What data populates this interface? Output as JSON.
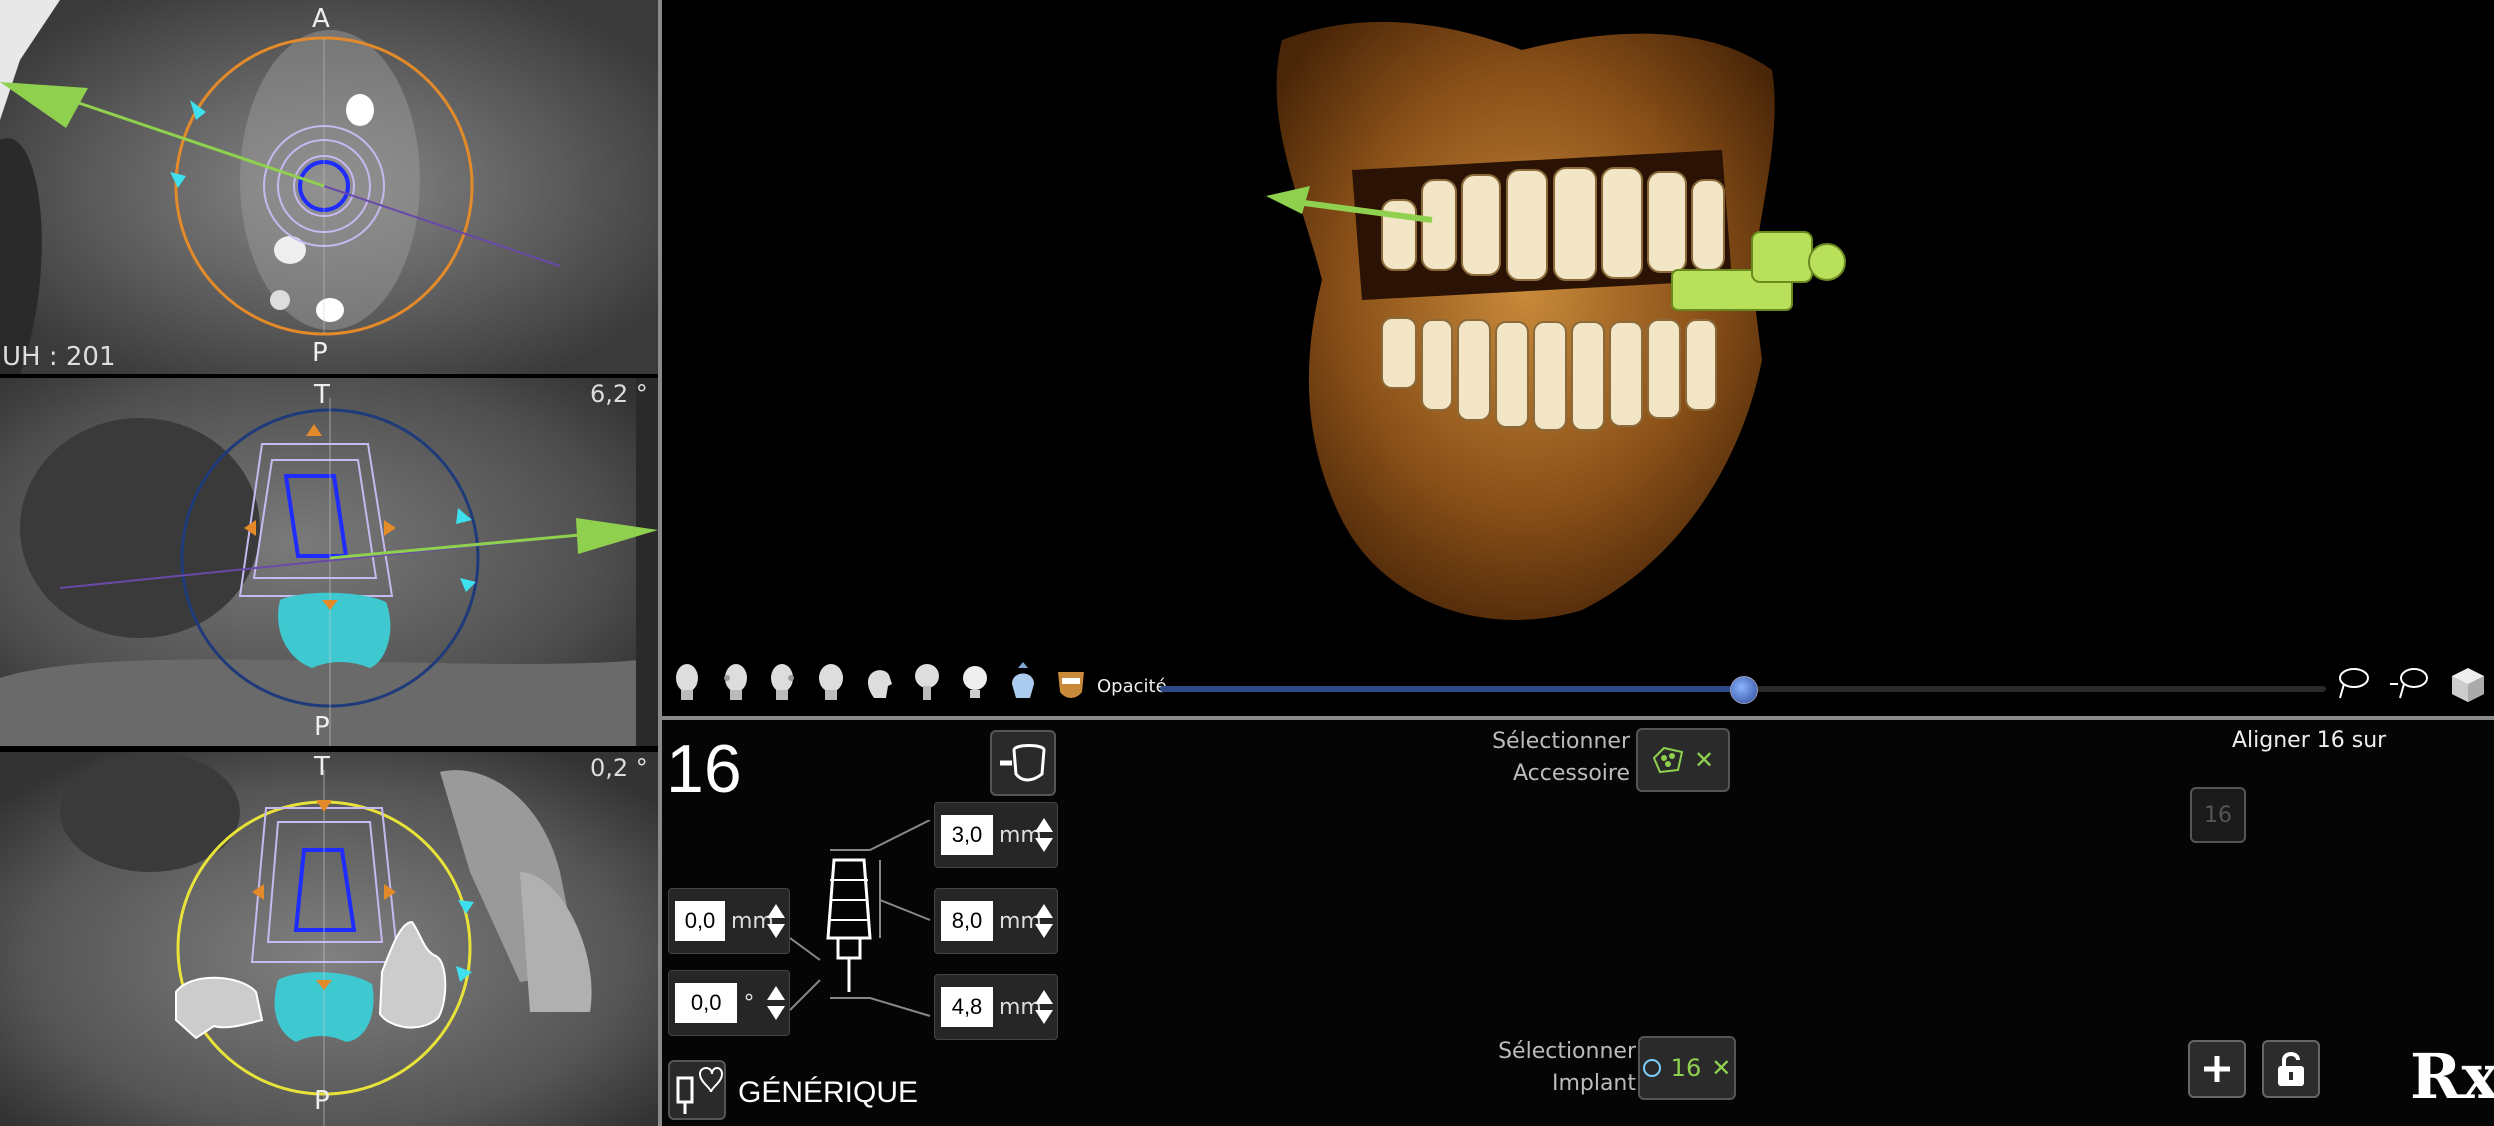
{
  "axial_view": {
    "top_label": "A",
    "bottom_label": "P",
    "uh_readout": "UH : 201"
  },
  "coronal_view": {
    "top_label": "T",
    "bottom_label": "P",
    "angle": "6,2 °"
  },
  "sagittal_view": {
    "top_label": "T",
    "bottom_label": "P",
    "angle": "0,2 °"
  },
  "render_view": {
    "preset_icons": [
      "head-front-icon",
      "head-left-icon",
      "head-right-icon",
      "head-three-quarter-icon",
      "head-profile-icon",
      "skull-top-icon",
      "bulb-icon",
      "tooth-crown-icon",
      "jaw-render-icon"
    ],
    "opacity_label": "Opacité",
    "opacity_value": 0.5,
    "tools": [
      "lasso-add-icon",
      "lasso-remove-icon",
      "cube-icon"
    ]
  },
  "implant_panel": {
    "tooth_number": "16",
    "offset_value": "0,0",
    "offset_unit": "mm",
    "angle_value": "0,0",
    "angle_unit": "°",
    "top_value": "3,0",
    "top_unit": "mm",
    "length_value": "8,0",
    "length_unit": "mm",
    "diameter_value": "4,8",
    "diameter_unit": "mm",
    "library_label": "GÉNÉRIQUE"
  },
  "accessory": {
    "line1": "Sélectionner",
    "line2": "Accessoire"
  },
  "implant_select": {
    "line1": "Sélectionner",
    "line2": "Implant",
    "chip_label": "16"
  },
  "align": {
    "title": "Aligner 16 sur",
    "chip": "16"
  },
  "logo": "Rx",
  "colors": {
    "accent_green": "#8fd14f",
    "slider_blue": "#2e4a88",
    "implant_blue": "#1f2cff",
    "orange_ring": "#e38a2a",
    "yellow_ring": "#e8e23a",
    "cyan_crown": "#3ec8cf"
  }
}
